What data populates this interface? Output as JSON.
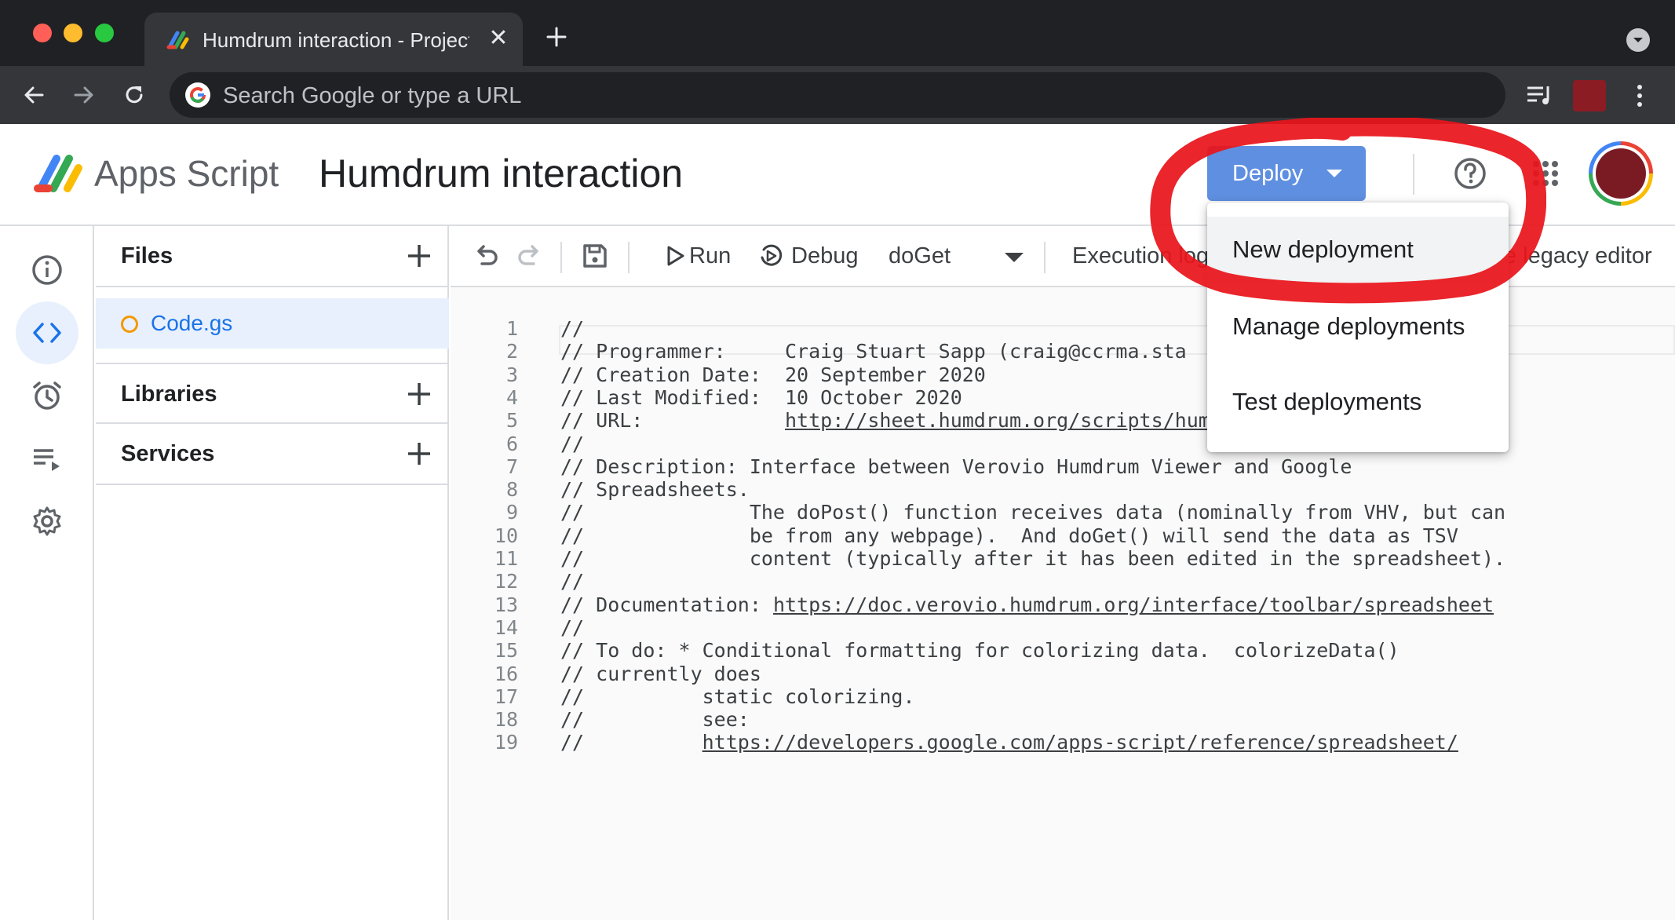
{
  "browser": {
    "tab_title": "Humdrum interaction - Project",
    "tab_close": "✕",
    "omnibox_placeholder": "Search Google or type a URL",
    "icons": [
      "back-icon",
      "forward-icon",
      "reload-icon",
      "google-icon",
      "media-control-icon",
      "extension-avatar",
      "more-vert-icon",
      "tab-search-icon",
      "new-tab-icon"
    ]
  },
  "header": {
    "app_name": "Apps Script",
    "project_title": "Humdrum interaction",
    "deploy_label": "Deploy",
    "colors": {
      "deploy_button": "#5f8fe0",
      "accent": "#1a73e8"
    }
  },
  "deploy_menu": {
    "items": [
      "New deployment",
      "Manage deployments",
      "Test deployments"
    ]
  },
  "rail": {
    "icons": [
      "info-icon",
      "code-icon",
      "alarm-icon",
      "executions-icon",
      "settings-icon"
    ],
    "active": "code-icon"
  },
  "files_panel": {
    "files_label": "Files",
    "file_name": "Code.gs",
    "libraries_label": "Libraries",
    "services_label": "Services"
  },
  "editor_toolbar": {
    "run_label": "Run",
    "debug_label": "Debug",
    "function_name": "doGet",
    "execution_log_label": "Execution log",
    "legacy_editor_label": "e legacy editor"
  },
  "code": {
    "lines": [
      "//",
      "// Programmer:     Craig Stuart Sapp (craig@ccrma.sta",
      "// Creation Date:  20 September 2020",
      "// Last Modified:  10 October 2020",
      "// URL:            http://sheet.humdrum.org/scripts/humdrum-sheet.js",
      "//",
      "// Description: Interface between Verovio Humdrum Viewer and Google",
      "// Spreadsheets.",
      "//              The doPost() function receives data (nominally from VHV, but can",
      "//              be from any webpage).  And doGet() will send the data as TSV",
      "//              content (typically after it has been edited in the spreadsheet).",
      "//",
      "// Documentation: https://doc.verovio.humdrum.org/interface/toolbar/spreadsheet",
      "//",
      "// To do: * Conditional formatting for colorizing data.  colorizeData()",
      "// currently does",
      "//          static colorizing.",
      "//          see:",
      "//          https://developers.google.com/apps-script/reference/spreadsheet/"
    ],
    "line_numbers": [
      "1",
      "2",
      "3",
      "4",
      "5",
      "6",
      "7",
      "8",
      "9",
      "10",
      "11",
      "12",
      "13",
      "14",
      "15",
      "16",
      "17",
      "18",
      "19"
    ]
  },
  "annotation": {
    "color": "#e8141b"
  }
}
